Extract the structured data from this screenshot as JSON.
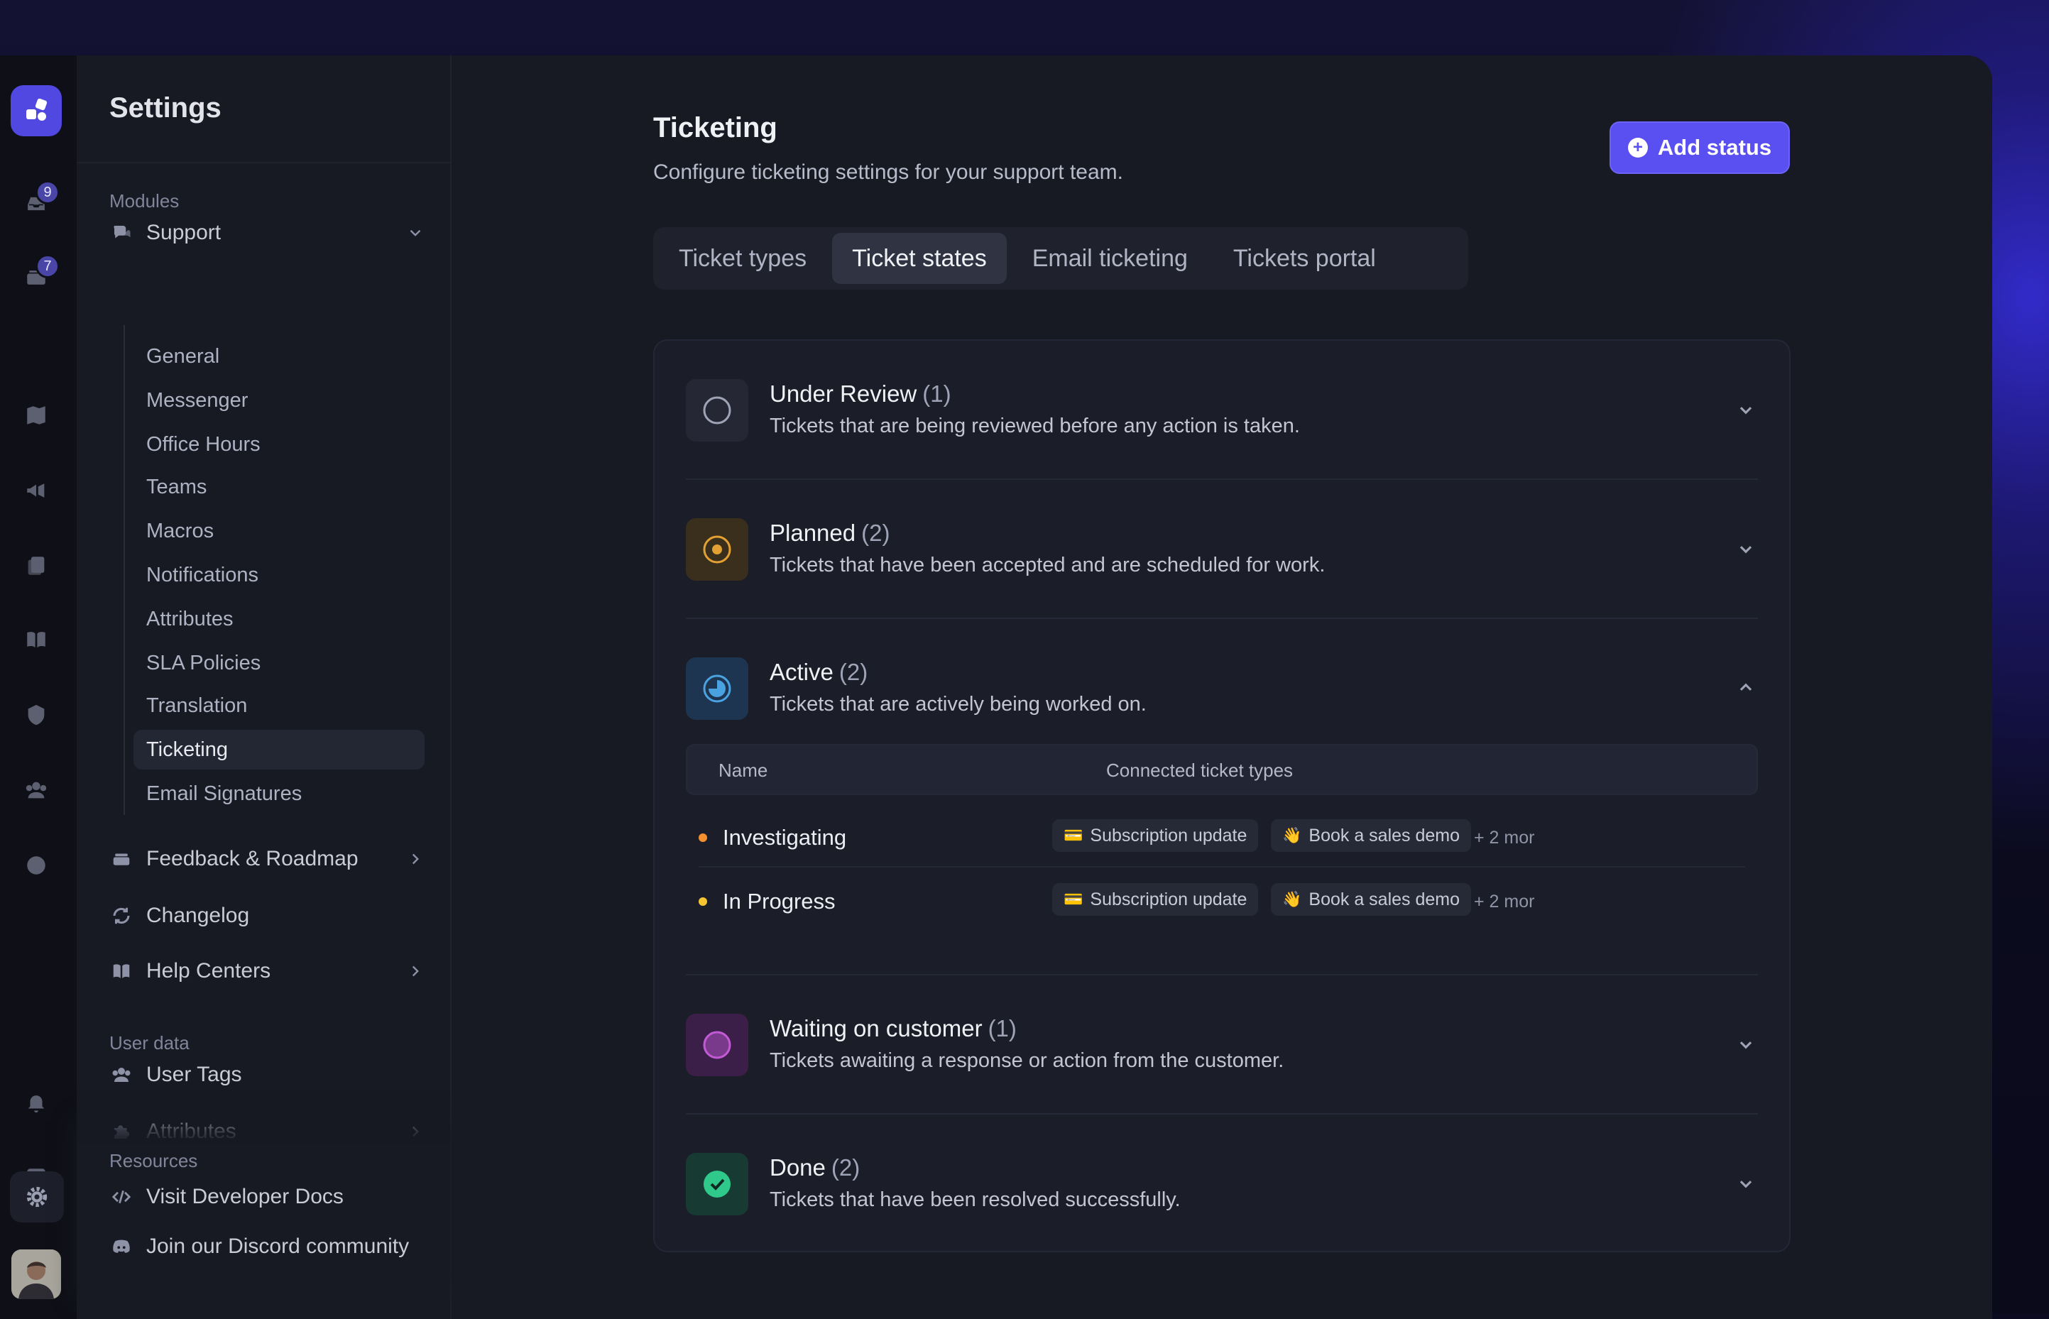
{
  "rail": {
    "inbox_badge": "9",
    "tickets_badge": "7"
  },
  "sidebar": {
    "title": "Settings",
    "modules_label": "Modules",
    "support_label": "Support",
    "support_items": [
      {
        "label": "General"
      },
      {
        "label": "Messenger"
      },
      {
        "label": "Office Hours"
      },
      {
        "label": "Teams"
      },
      {
        "label": "Macros"
      },
      {
        "label": "Notifications"
      },
      {
        "label": "Attributes"
      },
      {
        "label": "SLA Policies"
      },
      {
        "label": "Translation"
      },
      {
        "label": "Ticketing"
      },
      {
        "label": "Email Signatures"
      }
    ],
    "feedback_label": "Feedback & Roadmap",
    "changelog_label": "Changelog",
    "help_centers_label": "Help Centers",
    "user_data_label": "User data",
    "user_tags_label": "User Tags",
    "attributes_label": "Attributes",
    "resources_label": "Resources",
    "dev_docs_label": "Visit Developer Docs",
    "discord_label": "Join our Discord community"
  },
  "main": {
    "title": "Ticketing",
    "subtitle": "Configure ticketing settings for your support team.",
    "add_status_label": "Add status",
    "tabs": [
      {
        "label": "Ticket types"
      },
      {
        "label": "Ticket states"
      },
      {
        "label": "Email ticketing"
      },
      {
        "label": "Tickets portal"
      }
    ],
    "states": [
      {
        "name": "Under Review",
        "count": "(1)",
        "description": "Tickets that are being reviewed before any action is taken."
      },
      {
        "name": "Planned",
        "count": "(2)",
        "description": "Tickets that have been accepted and are scheduled for work."
      },
      {
        "name": "Active",
        "count": "(2)",
        "description": "Tickets that are actively being worked on."
      },
      {
        "name": "Waiting on customer",
        "count": "(1)",
        "description": "Tickets awaiting a response or action from the customer."
      },
      {
        "name": "Done",
        "count": "(2)",
        "description": "Tickets that have been resolved successfully."
      }
    ],
    "active_table": {
      "col_name": "Name",
      "col_types": "Connected ticket types",
      "rows": [
        {
          "name": "Investigating",
          "dot_color": "#f5902e",
          "chip1": "Subscription update",
          "chip2": "Book a sales demo",
          "more": "+ 2 mor"
        },
        {
          "name": "In Progress",
          "dot_color": "#f6c531",
          "chip1": "Subscription update",
          "chip2": "Book a sales demo",
          "more": "+ 2 mor"
        }
      ]
    }
  },
  "colors": {
    "accent": "#5a4ff0",
    "planned": "#e3a133",
    "active": "#4aa3e0",
    "waiting": "#c25ad6",
    "done": "#2fc98b"
  }
}
